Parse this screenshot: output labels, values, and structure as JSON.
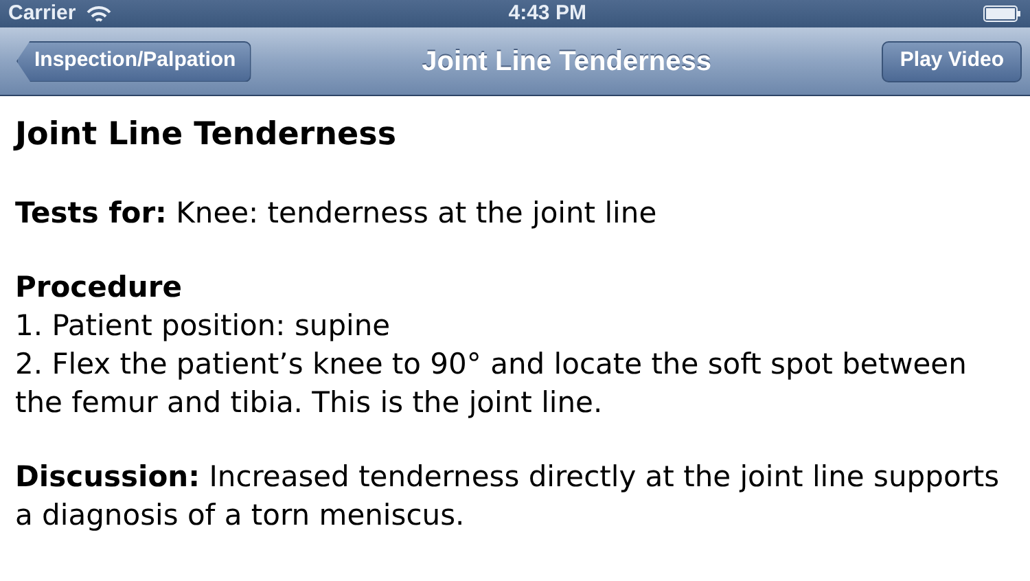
{
  "status_bar": {
    "carrier": "Carrier",
    "time": "4:43 PM"
  },
  "nav_bar": {
    "back_button": "Inspection/Palpation",
    "title": "Joint Line Tenderness",
    "action_button": "Play Video"
  },
  "content": {
    "title": "Joint Line Tenderness",
    "blocks": [
      {
        "paragraphs": [
          "**Tests for:** Knee: tenderness at the joint line"
        ]
      },
      {
        "heading": "Procedure",
        "paragraphs": [
          "1. Patient position: supine",
          "2. Flex the patient’s knee to 90° and locate the soft spot between the femur and tibia. This is the joint line."
        ]
      },
      {
        "paragraphs": [
          "**Discussion:** Increased tenderness directly at the joint line supports a diagnosis of a torn meniscus."
        ]
      }
    ]
  }
}
